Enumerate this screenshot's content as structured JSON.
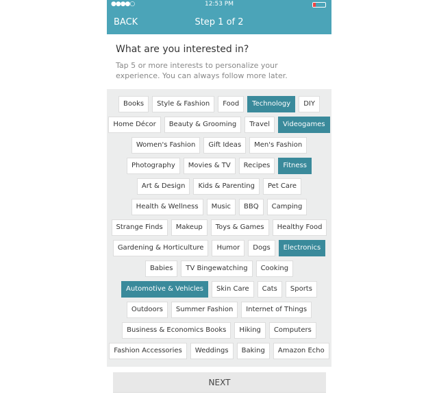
{
  "status": {
    "time": "12:53 PM",
    "signal": "●●●●○"
  },
  "nav": {
    "back": "BACK",
    "title": "Step 1 of 2"
  },
  "intro": {
    "heading": "What are you interested in?",
    "text": "Tap 5 or more interests to personalize your experience. You can always follow more later."
  },
  "colors": {
    "header": "#4ba4b8",
    "selected": "#3a8a9b"
  },
  "rows": [
    [
      {
        "label": "Books"
      },
      {
        "label": "Style & Fashion"
      },
      {
        "label": "Food"
      },
      {
        "label": "Technology",
        "selected": true
      },
      {
        "label": "DIY"
      }
    ],
    [
      {
        "label": "Home Décor"
      },
      {
        "label": "Beauty & Grooming"
      },
      {
        "label": "Travel"
      },
      {
        "label": "Videogames",
        "selected": true
      }
    ],
    [
      {
        "label": "Women's Fashion"
      },
      {
        "label": "Gift Ideas"
      },
      {
        "label": "Men's Fashion"
      }
    ],
    [
      {
        "label": "Photography"
      },
      {
        "label": "Movies & TV"
      },
      {
        "label": "Recipes"
      },
      {
        "label": "Fitness",
        "selected": true
      }
    ],
    [
      {
        "label": "Art & Design"
      },
      {
        "label": "Kids & Parenting"
      },
      {
        "label": "Pet Care"
      }
    ],
    [
      {
        "label": "Health & Wellness"
      },
      {
        "label": "Music"
      },
      {
        "label": "BBQ"
      },
      {
        "label": "Camping"
      }
    ],
    [
      {
        "label": "Strange Finds"
      },
      {
        "label": "Makeup"
      },
      {
        "label": "Toys & Games"
      },
      {
        "label": "Healthy Food"
      }
    ],
    [
      {
        "label": "Gardening & Horticulture"
      },
      {
        "label": "Humor"
      },
      {
        "label": "Dogs"
      },
      {
        "label": "Electronics",
        "selected": true
      }
    ],
    [
      {
        "label": "Babies"
      },
      {
        "label": "TV Bingewatching"
      },
      {
        "label": "Cooking"
      }
    ],
    [
      {
        "label": "Automotive & Vehicles",
        "selected": true
      },
      {
        "label": "Skin Care"
      },
      {
        "label": "Cats"
      },
      {
        "label": "Sports"
      }
    ],
    [
      {
        "label": "Outdoors"
      },
      {
        "label": "Summer Fashion"
      },
      {
        "label": "Internet of Things"
      }
    ],
    [
      {
        "label": "Business & Economics Books"
      },
      {
        "label": "Hiking"
      },
      {
        "label": "Computers"
      }
    ],
    [
      {
        "label": "Fashion Accessories"
      },
      {
        "label": "Weddings"
      },
      {
        "label": "Baking"
      },
      {
        "label": "Amazon Echo"
      }
    ]
  ],
  "next": "NEXT"
}
